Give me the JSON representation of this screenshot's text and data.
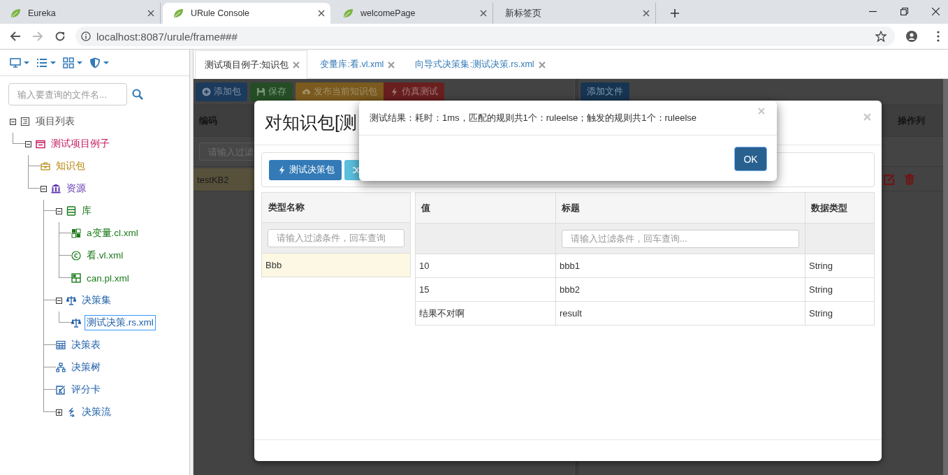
{
  "browser": {
    "tabs": [
      {
        "title": "Eureka",
        "kind": "site",
        "selected": false
      },
      {
        "title": "URule Console",
        "kind": "site",
        "selected": true
      },
      {
        "title": "welcomePage",
        "kind": "site",
        "selected": false
      },
      {
        "title": "新标签页",
        "kind": "blank",
        "selected": false
      }
    ],
    "url": "localhost:8087/urule/frame###"
  },
  "sidebar": {
    "search": {
      "placeholder": "输入要查询的文件名..."
    },
    "tree": [
      {
        "label": "项目列表",
        "kind": "list",
        "color": "#555555",
        "expanded": true,
        "selected": false,
        "children": [
          {
            "label": "测试项目例子",
            "kind": "project",
            "color": "#c2185b",
            "expanded": true,
            "selected": false,
            "children": [
              {
                "label": "知识包",
                "kind": "package",
                "color": "#b8860b",
                "selected": false
              },
              {
                "label": "资源",
                "kind": "resources",
                "color": "#5e35b1",
                "expanded": true,
                "selected": false,
                "children": [
                  {
                    "label": "库",
                    "kind": "library",
                    "color": "#1b7a1b",
                    "expanded": true,
                    "selected": false,
                    "children": [
                      {
                        "label": "a变量.cl.xml",
                        "kind": "variable",
                        "color": "#1b7a1b",
                        "selected": false
                      },
                      {
                        "label": "看.vl.xml",
                        "kind": "constant",
                        "color": "#1b7a1b",
                        "selected": false
                      },
                      {
                        "label": "can.pl.xml",
                        "kind": "parameter",
                        "color": "#1b7a1b",
                        "selected": false
                      }
                    ]
                  },
                  {
                    "label": "决策集",
                    "kind": "ruleset",
                    "color": "#1f5fa8",
                    "expanded": true,
                    "selected": false,
                    "children": [
                      {
                        "label": "测试决策.rs.xml",
                        "kind": "ruleset",
                        "color": "#1f5fa8",
                        "selected": true
                      }
                    ]
                  },
                  {
                    "label": "决策表",
                    "kind": "table",
                    "color": "#1f5fa8",
                    "selected": false
                  },
                  {
                    "label": "决策树",
                    "kind": "tree",
                    "color": "#1f5fa8",
                    "selected": false
                  },
                  {
                    "label": "评分卡",
                    "kind": "scorecard",
                    "color": "#1f5fa8",
                    "selected": false
                  },
                  {
                    "label": "决策流",
                    "kind": "flow",
                    "color": "#1f5fa8",
                    "expanded": false,
                    "selected": false
                  }
                ]
              }
            ]
          }
        ]
      }
    ]
  },
  "tabs": [
    {
      "label": "测试项目例子:知识包",
      "selected": true
    },
    {
      "label": "变量库:看.vl.xml",
      "selected": false
    },
    {
      "label": "向导式决策集:测试决策.rs.xml",
      "selected": false
    }
  ],
  "package_pane": {
    "buttons": [
      {
        "label": "添加包",
        "kind": "add"
      },
      {
        "label": "保存",
        "kind": "save"
      },
      {
        "label": "发布当前知识包",
        "kind": "publish"
      },
      {
        "label": "仿真测试",
        "kind": "simulate"
      }
    ],
    "column_header": "编码",
    "filter": {
      "placeholder": "请输入过滤"
    },
    "rows": [
      {
        "code": "testKB2",
        "selected": true
      }
    ]
  },
  "file_pane": {
    "button": "添加文件",
    "action_header": "操作列"
  },
  "modal": {
    "title": "对知识包[测",
    "buttons": [
      {
        "label": "测试决策包",
        "kind": "test"
      },
      {
        "kind": "shuffle"
      }
    ],
    "type_table": {
      "header": "类型名称",
      "filter": {
        "placeholder": "请输入过滤条件，回车查询"
      },
      "rows": [
        {
          "name": "Bbb",
          "selected": true
        }
      ]
    },
    "value_table": {
      "columns": [
        "值",
        "标题",
        "数据类型"
      ],
      "filter": {
        "placeholder": "请输入过滤条件，回车查询..."
      },
      "rows": [
        {
          "value": "10",
          "title": "bbb1",
          "type": "String"
        },
        {
          "value": "15",
          "title": "bbb2",
          "type": "String"
        },
        {
          "value": "结果不对啊",
          "title": "result",
          "type": "String"
        }
      ]
    }
  },
  "alert": {
    "message": "测试结果：耗时：1ms，匹配的规则共1个：ruleelse；触发的规则共1个：ruleelse",
    "button": "OK"
  }
}
